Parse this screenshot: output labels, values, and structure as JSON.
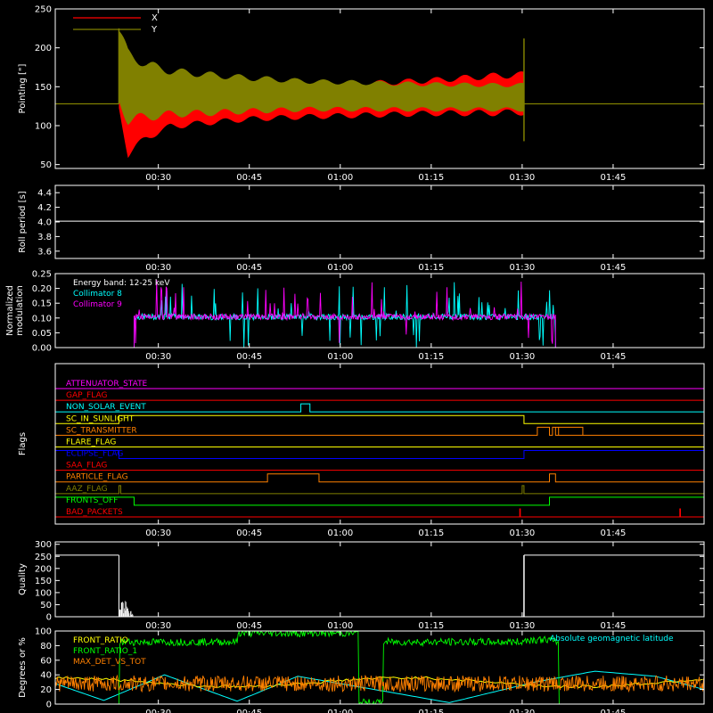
{
  "colors": {
    "bg": "#000000",
    "axis": "#ffffff",
    "red": "#ff0000",
    "olive": "#808000",
    "cyan": "#00ffff",
    "magenta": "#ff00ff",
    "green": "#00ff00",
    "orange": "#ff8000",
    "yellow": "#ffff00",
    "blue": "#0000ff",
    "brown": "#ff5000"
  },
  "chart_data": [
    {
      "id": "pointing",
      "type": "area",
      "ylabel": "Pointing [\"]",
      "ylim": [
        45,
        250
      ],
      "yticks": [
        {
          "v": 50,
          "label": "50"
        },
        {
          "v": 100,
          "label": "100"
        },
        {
          "v": 150,
          "label": "150"
        },
        {
          "v": 200,
          "label": "200"
        },
        {
          "v": 250,
          "label": "250"
        }
      ],
      "xticks": [
        {
          "v": 30,
          "label": "00:30"
        },
        {
          "v": 45,
          "label": "00:45"
        },
        {
          "v": 60,
          "label": "01:00"
        },
        {
          "v": 75,
          "label": "01:15"
        },
        {
          "v": 90,
          "label": "01:30"
        },
        {
          "v": 105,
          "label": "01:45"
        }
      ],
      "legend": [
        {
          "name": "X",
          "color": "#ff0000"
        },
        {
          "name": "Y",
          "color": "#808000"
        }
      ],
      "baseline": 128,
      "envelope": [
        {
          "series": "X",
          "color": "#ff0000",
          "t": [
            23.5,
            25,
            28,
            32,
            38,
            45,
            55,
            65,
            75,
            85,
            90.3
          ],
          "lo": [
            120,
            58,
            80,
            95,
            100,
            105,
            108,
            110,
            112,
            112,
            113
          ],
          "hi": [
            155,
            130,
            140,
            148,
            150,
            152,
            155,
            158,
            162,
            168,
            170
          ]
        },
        {
          "series": "Y",
          "color": "#808000",
          "t": [
            23.5,
            25,
            28,
            32,
            38,
            45,
            55,
            65,
            75,
            85,
            90.3
          ],
          "lo": [
            125,
            100,
            105,
            110,
            112,
            115,
            118,
            118,
            118,
            118,
            118
          ],
          "hi": [
            230,
            200,
            185,
            175,
            170,
            165,
            160,
            158,
            156,
            155,
            155
          ]
        }
      ]
    },
    {
      "id": "roll",
      "type": "line",
      "ylabel": "Roll period [s]",
      "ylim": [
        3.5,
        4.5
      ],
      "yticks": [
        {
          "v": 3.6,
          "label": "3.6"
        },
        {
          "v": 3.8,
          "label": "3.8"
        },
        {
          "v": 4.0,
          "label": "4.0"
        },
        {
          "v": 4.2,
          "label": "4.2"
        },
        {
          "v": 4.4,
          "label": "4.4"
        }
      ],
      "xticks": [
        {
          "v": 30,
          "label": "00:30"
        },
        {
          "v": 45,
          "label": "00:45"
        },
        {
          "v": 60,
          "label": "01:00"
        },
        {
          "v": 75,
          "label": "01:15"
        },
        {
          "v": 90,
          "label": "01:30"
        },
        {
          "v": 105,
          "label": "01:45"
        }
      ],
      "series": [
        {
          "color": "#ffffff",
          "x": [
            13,
            120
          ],
          "y": [
            4.01,
            4.01
          ]
        }
      ]
    },
    {
      "id": "modulation",
      "type": "line",
      "ylabel": "Normalized modulation",
      "ylim": [
        0,
        0.25
      ],
      "yticks": [
        {
          "v": 0,
          "label": "0.00"
        },
        {
          "v": 0.05,
          "label": "0.05"
        },
        {
          "v": 0.1,
          "label": "0.10"
        },
        {
          "v": 0.15,
          "label": "0.15"
        },
        {
          "v": 0.2,
          "label": "0.20"
        },
        {
          "v": 0.25,
          "label": "0.25"
        }
      ],
      "xticks": [
        {
          "v": 30,
          "label": "00:30"
        },
        {
          "v": 45,
          "label": "00:45"
        },
        {
          "v": 60,
          "label": "01:00"
        },
        {
          "v": 75,
          "label": "01:15"
        },
        {
          "v": 90,
          "label": "01:30"
        },
        {
          "v": 105,
          "label": "01:45"
        }
      ],
      "legend": [
        {
          "name": "Energy band: 12-25 keV",
          "color": "#ffffff"
        },
        {
          "name": "Collimator 8",
          "color": "#00ffff"
        },
        {
          "name": "Collimator 9",
          "color": "#ff00ff"
        }
      ],
      "active": [
        26,
        95.5
      ],
      "level": 0.1
    },
    {
      "id": "flags",
      "type": "line",
      "ylabel": "Flags",
      "xticks": [
        {
          "v": 30,
          "label": "00:30"
        },
        {
          "v": 45,
          "label": "00:45"
        },
        {
          "v": 60,
          "label": "01:00"
        },
        {
          "v": 75,
          "label": "01:15"
        },
        {
          "v": 90,
          "label": "01:30"
        },
        {
          "v": 105,
          "label": "01:45"
        }
      ],
      "flags": [
        {
          "name": "ATTENUATOR_STATE",
          "color": "#ff00ff",
          "hi": []
        },
        {
          "name": "GAP_FLAG",
          "color": "#ff0000",
          "hi": []
        },
        {
          "name": "NON_SOLAR_EVENT",
          "color": "#00ffff",
          "hi": [
            [
              53.5,
              55
            ]
          ]
        },
        {
          "name": "SC_IN_SUNLIGHT",
          "color": "#ffff00",
          "hi": [
            [
              23.5,
              90.3
            ]
          ]
        },
        {
          "name": "SC_TRANSMITTER",
          "color": "#ff8000",
          "hi": [
            [
              92.5,
              94.5
            ],
            [
              95,
              100
            ],
            [
              95.5,
              96
            ]
          ]
        },
        {
          "name": "FLARE_FLAG",
          "color": "#ffff00",
          "hi": []
        },
        {
          "name": "ECLIPSE_FLAG",
          "color": "#0000ff",
          "hi": [
            [
              13,
              23.5
            ],
            [
              90.3,
              120
            ]
          ]
        },
        {
          "name": "SAA_FLAG",
          "color": "#ff0000",
          "hi": []
        },
        {
          "name": "PARTICLE_FLAG",
          "color": "#ff8000",
          "hi": [
            [
              48,
              56.5
            ],
            [
              94.5,
              95.5
            ]
          ]
        },
        {
          "name": "AAZ_FLAG",
          "color": "#808000",
          "hi": [
            [
              23.5,
              23.8
            ],
            [
              90,
              90.3
            ]
          ]
        },
        {
          "name": "FRONTS_OFF",
          "color": "#00ff00",
          "hi": [
            [
              13,
              26
            ],
            [
              94.5,
              120
            ]
          ]
        },
        {
          "name": "BAD_PACKETS",
          "color": "#ff0000",
          "hi": [
            [
              89.6,
              89.7
            ],
            [
              116,
              116.1
            ]
          ]
        }
      ]
    },
    {
      "id": "quality",
      "type": "bar",
      "ylabel": "Quality",
      "ylim": [
        0,
        310
      ],
      "yticks": [
        {
          "v": 0,
          "label": "0"
        },
        {
          "v": 50,
          "label": "50"
        },
        {
          "v": 100,
          "label": "100"
        },
        {
          "v": 150,
          "label": "150"
        },
        {
          "v": 200,
          "label": "200"
        },
        {
          "v": 250,
          "label": "250"
        },
        {
          "v": 300,
          "label": "300"
        }
      ],
      "xticks": [
        {
          "v": 30,
          "label": "00:30"
        },
        {
          "v": 45,
          "label": "00:45"
        },
        {
          "v": 60,
          "label": "01:00"
        },
        {
          "v": 75,
          "label": "01:15"
        },
        {
          "v": 90,
          "label": "01:30"
        },
        {
          "v": 105,
          "label": "01:45"
        }
      ],
      "segments": [
        {
          "x": [
            13,
            23.5
          ],
          "v": 255
        },
        {
          "x": [
            90.3,
            120
          ],
          "v": 255
        }
      ]
    },
    {
      "id": "ratios",
      "type": "line",
      "ylabel": "Degrees or %",
      "ylim": [
        0,
        100
      ],
      "yticks": [
        {
          "v": 0,
          "label": "0"
        },
        {
          "v": 20,
          "label": "20"
        },
        {
          "v": 40,
          "label": "40"
        },
        {
          "v": 60,
          "label": "60"
        },
        {
          "v": 80,
          "label": "80"
        },
        {
          "v": 100,
          "label": "100"
        }
      ],
      "xticks": [
        {
          "v": 30,
          "label": "00:30"
        },
        {
          "v": 45,
          "label": "00:45"
        },
        {
          "v": 60,
          "label": "01:00"
        },
        {
          "v": 75,
          "label": "01:15"
        },
        {
          "v": 90,
          "label": "01:30"
        },
        {
          "v": 105,
          "label": "01:45"
        }
      ],
      "legend": [
        {
          "name": "FRONT_RATIO",
          "color": "#ffff00"
        },
        {
          "name": "FRONT_RATIO_1",
          "color": "#00ff00"
        },
        {
          "name": "MAX_DET_VS_TOT",
          "color": "#ff8000"
        }
      ],
      "annotation": {
        "text": "Absolute geomagnetic latitude",
        "color": "#00ffff"
      },
      "geomag": {
        "x": [
          13,
          21,
          31,
          43,
          53,
          67,
          78,
          92,
          102,
          112,
          120
        ],
        "y": [
          28,
          5,
          40,
          4,
          38,
          18,
          2,
          30,
          45,
          38,
          20
        ]
      }
    }
  ]
}
